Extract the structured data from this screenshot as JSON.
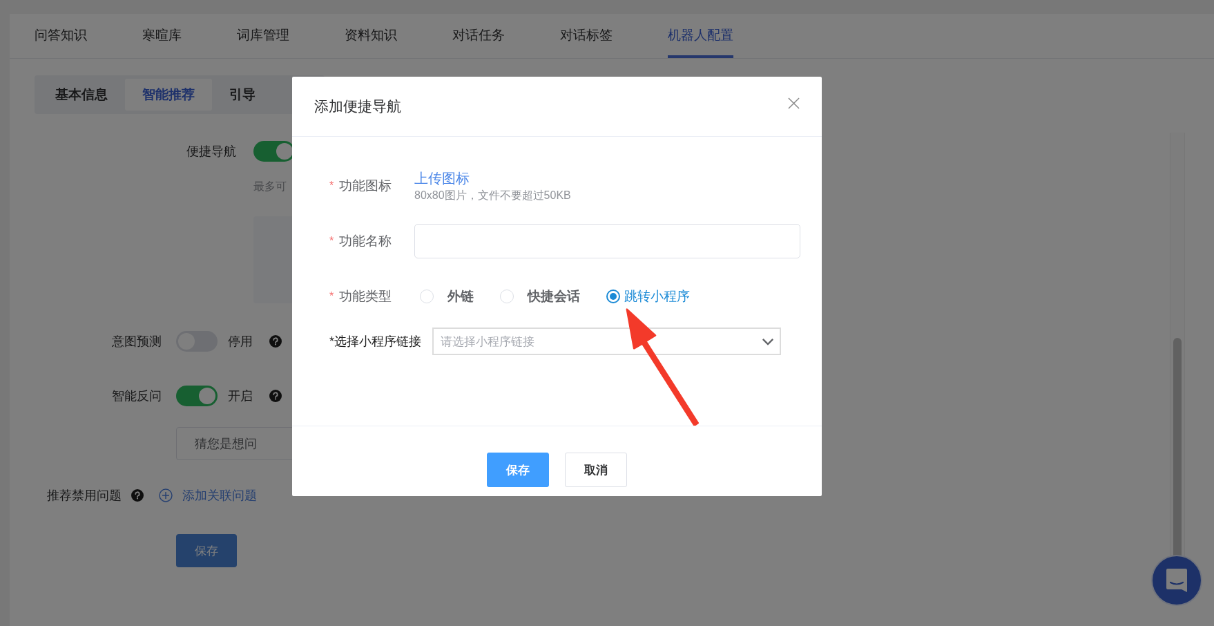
{
  "tabs": [
    {
      "label": "问答知识",
      "selected": false
    },
    {
      "label": "寒暄库",
      "selected": false
    },
    {
      "label": "词库管理",
      "selected": false
    },
    {
      "label": "资料知识",
      "selected": false
    },
    {
      "label": "对话任务",
      "selected": false
    },
    {
      "label": "对话标签",
      "selected": false
    },
    {
      "label": "机器人配置",
      "selected": true
    }
  ],
  "subtabs": [
    {
      "label": "基本信息",
      "selected": false
    },
    {
      "label": "智能推荐",
      "selected": true
    },
    {
      "label": "引导",
      "selected": false
    }
  ],
  "quick_nav": {
    "label": "便捷导航",
    "on": true,
    "note": "最多可"
  },
  "switches": [
    {
      "label": "意图预测",
      "on": false,
      "status": "停用"
    },
    {
      "label": "智能反问",
      "on": true,
      "status": "开启"
    }
  ],
  "clarify_input": {
    "value": "猜您是想问"
  },
  "blocked_questions": {
    "label": "推荐禁用问题",
    "link": "添加关联问题"
  },
  "save_button": "保存",
  "dialog": {
    "title": "添加便捷导航",
    "fields": [
      {
        "kind": "upload",
        "mark": "*",
        "label": "功能图标",
        "link": "上传图标",
        "hint": "80x80图片，文件不要超过50KB"
      },
      {
        "kind": "text",
        "mark": "*",
        "label": "功能名称"
      },
      {
        "kind": "radio",
        "mark": "*",
        "label": "功能类型",
        "options": [
          {
            "label": "外链",
            "selected": false
          },
          {
            "label": "快捷会话",
            "selected": false
          },
          {
            "label": "跳转小程序",
            "selected": true
          }
        ]
      },
      {
        "kind": "select",
        "label": "*选择小程序链接",
        "placeholder": "请选择小程序链接"
      }
    ],
    "buttons": [
      {
        "label": "保存",
        "kind": "primary"
      },
      {
        "label": "取消",
        "kind": "default"
      }
    ]
  }
}
